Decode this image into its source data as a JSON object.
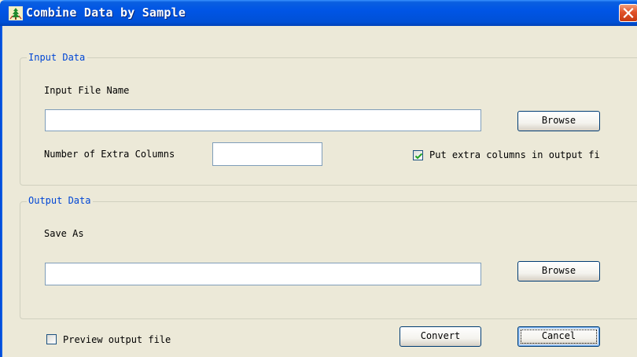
{
  "window": {
    "title": "Combine Data by Sample",
    "app_icon": "tree-icon",
    "close_icon": "close-icon"
  },
  "input_group": {
    "legend": "Input Data",
    "file_name_label": "Input File Name",
    "file_name_value": "",
    "browse_label": "Browse",
    "extra_columns_label": "Number of Extra Columns",
    "extra_columns_value": "",
    "put_extra_checkbox_label": "Put extra columns in output fi",
    "put_extra_checked": true
  },
  "output_group": {
    "legend": "Output Data",
    "save_as_label": "Save As",
    "save_as_value": "",
    "browse_label": "Browse"
  },
  "footer": {
    "preview_checkbox_label": "Preview output file",
    "preview_checked": false,
    "convert_label": "Convert",
    "cancel_label": "Cancel"
  },
  "colors": {
    "titlebar": "#0055e5",
    "dialog_bg": "#ece9d8",
    "group_legend": "#0046d5",
    "close_button": "#e0522a",
    "checkmark": "#21a121"
  }
}
